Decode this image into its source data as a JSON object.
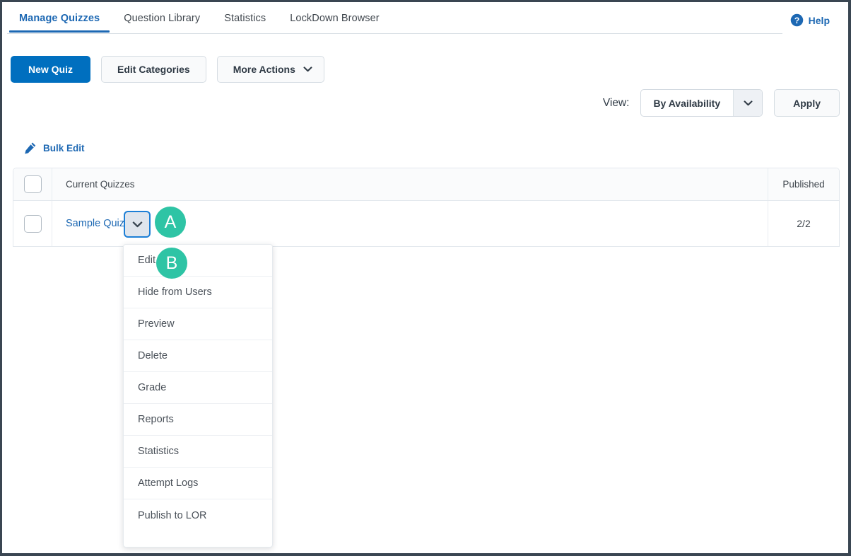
{
  "colors": {
    "brand_blue": "#1d68b3",
    "primary_button": "#006fbf",
    "badge_teal": "#2ec4a5",
    "frame_border": "#3a4652"
  },
  "nav": {
    "tabs": [
      {
        "label": "Manage Quizzes",
        "active": true
      },
      {
        "label": "Question Library",
        "active": false
      },
      {
        "label": "Statistics",
        "active": false
      },
      {
        "label": "LockDown Browser",
        "active": false
      }
    ],
    "help": {
      "label": "Help",
      "icon": "help-circle-icon"
    }
  },
  "toolbar": {
    "new_quiz_label": "New Quiz",
    "edit_categories_label": "Edit Categories",
    "more_actions_label": "More Actions",
    "more_actions_icon": "chevron-down-icon"
  },
  "view_controls": {
    "label": "View:",
    "selected_option": "By Availability",
    "options": [
      "By Availability"
    ],
    "dropdown_icon": "chevron-down-icon",
    "apply_label": "Apply"
  },
  "bulk_edit": {
    "label": "Bulk Edit",
    "icon": "pencil-icon"
  },
  "table": {
    "columns": [
      "",
      "Current Quizzes",
      "Published"
    ],
    "header": {
      "select_all_checkbox": "checkbox",
      "name_column": "Current Quizzes",
      "published_column": "Published"
    },
    "rows": [
      {
        "checkbox": "checkbox",
        "name": "Sample Quiz",
        "context_menu_icon": "chevron-down-icon",
        "published": "2/2"
      }
    ]
  },
  "context_menu": {
    "items": [
      {
        "label": "Edit"
      },
      {
        "label": "Hide from Users"
      },
      {
        "label": "Preview"
      },
      {
        "label": "Delete"
      },
      {
        "label": "Grade"
      },
      {
        "label": "Reports"
      },
      {
        "label": "Statistics"
      },
      {
        "label": "Attempt Logs"
      },
      {
        "label": "Publish to LOR"
      }
    ]
  },
  "callouts": [
    {
      "id": "A",
      "letter": "A",
      "target": "quiz-context-menu-trigger"
    },
    {
      "id": "B",
      "letter": "B",
      "target": "context-menu-item-edit"
    }
  ]
}
